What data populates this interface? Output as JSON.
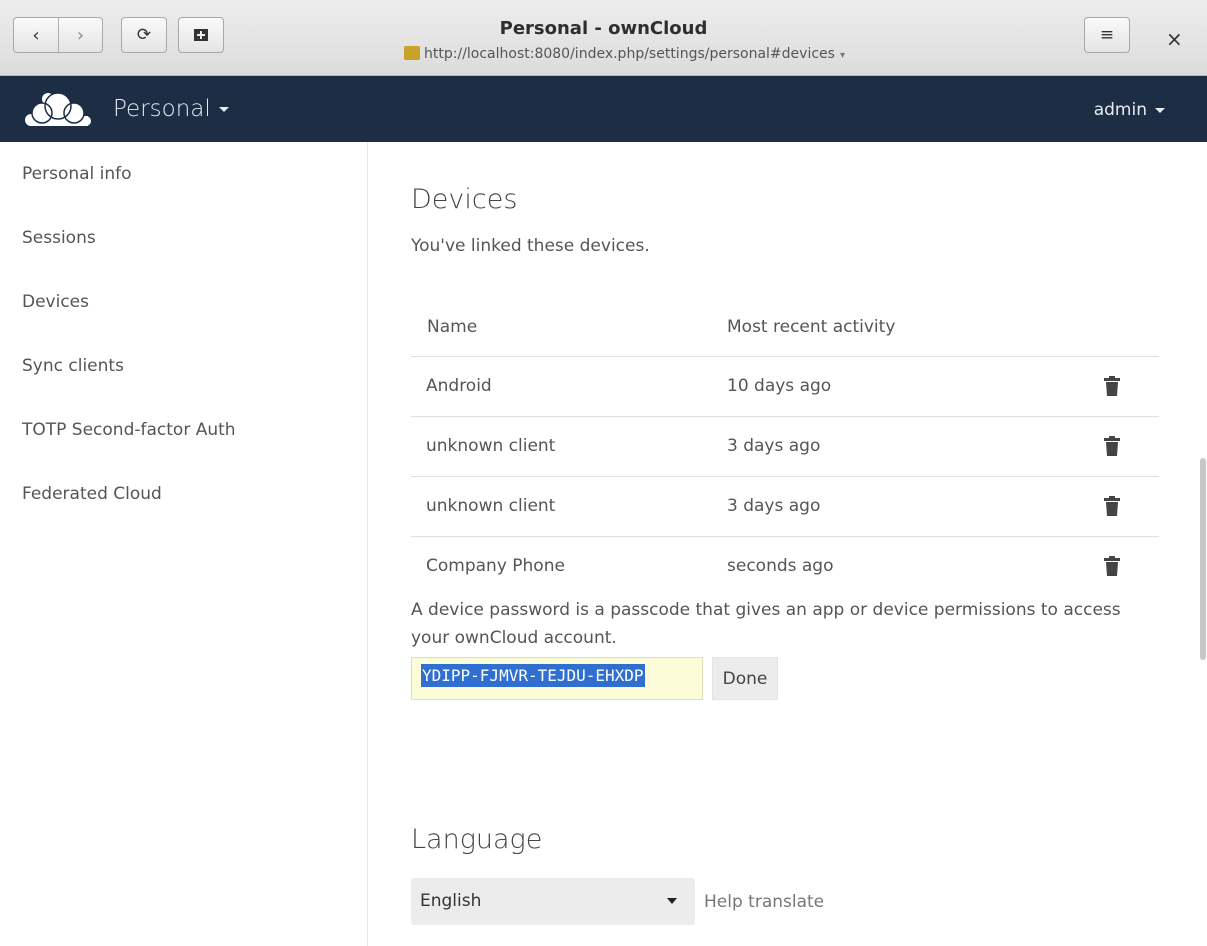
{
  "browser": {
    "title": "Personal - ownCloud",
    "url": "http://localhost:8080/index.php/settings/personal#devices",
    "back": "‹",
    "forward": "›",
    "reload": "⟳",
    "menu": "≡",
    "close": "×"
  },
  "header": {
    "app_name": "Personal",
    "user": "admin"
  },
  "sidebar": {
    "items": [
      {
        "label": "Personal info"
      },
      {
        "label": "Sessions"
      },
      {
        "label": "Devices"
      },
      {
        "label": "Sync clients"
      },
      {
        "label": "TOTP Second-factor Auth"
      },
      {
        "label": "Federated Cloud"
      }
    ]
  },
  "devices": {
    "title": "Devices",
    "description": "You've linked these devices.",
    "columns": [
      "Name",
      "Most recent activity"
    ],
    "rows": [
      {
        "name": "Android",
        "activity": "10 days ago"
      },
      {
        "name": "unknown client",
        "activity": "3 days ago"
      },
      {
        "name": "unknown client",
        "activity": "3 days ago"
      },
      {
        "name": "Company Phone",
        "activity": "seconds ago"
      }
    ],
    "explanation": "A device password is a passcode that gives an app or device permissions to access your ownCloud account.",
    "token": "YDIPP-FJMVR-TEJDU-EHXDP",
    "done_label": "Done"
  },
  "language": {
    "title": "Language",
    "selected": "English",
    "help_link": "Help translate"
  },
  "colors": {
    "header_bg": "#1d2d44",
    "selection": "#2f6fcf",
    "token_bg": "#fcfcd9"
  }
}
